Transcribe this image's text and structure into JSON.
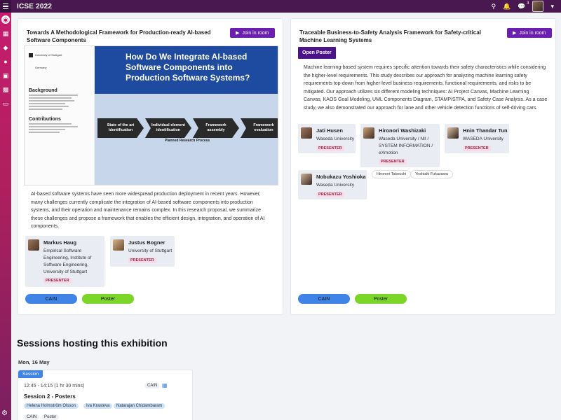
{
  "app": {
    "title": "ICSE 2022"
  },
  "topbar": {
    "icons": [
      "search-icon",
      "bell-icon",
      "chat-icon",
      "avatar",
      "chevron-down-icon"
    ],
    "message_count": "3"
  },
  "sidebar": {
    "items": [
      "home-icon",
      "calendar-icon",
      "tag-icon",
      "users-icon",
      "puzzle-icon",
      "bag-icon",
      "folder-icon"
    ],
    "bottom": "gear-icon"
  },
  "left_card": {
    "title": "Towards A Methodological Framework for Production-ready AI-based Software Components",
    "join_label": "Join in room",
    "poster": {
      "university": "University of Stuttgart",
      "university_sub": "Germany",
      "background_heading": "Background",
      "contributions_heading": "Contributions",
      "banner": "How Do We Integrate AI-based Software Components into Production Software Systems?",
      "steps": [
        "State of the art identification",
        "Individual element identification",
        "Framework assembly",
        "Framework evaluation"
      ],
      "caption": "Planned Research Process"
    },
    "abstract": "AI-based software systems have seen more widespread production deployment in recent years. However, many challenges currently complicate the integration of AI-based software components into production systems, and their operation and maintenance remains complex. In this research proposal, we summarize these challenges and propose a framework that enables the efficient design, integration, and operation of AI components.",
    "authors": [
      {
        "name": "Markus Haug",
        "affiliation": "Empirical Software Engineering, Institute of Software Engineering, University of Stuttgart",
        "badge": "PRESENTER"
      },
      {
        "name": "Justus Bogner",
        "affiliation": "University of Stuttgart",
        "badge": "PRESENTER"
      }
    ],
    "tags": [
      "CAIN",
      "Poster"
    ]
  },
  "right_card": {
    "title": "Traceable Business-to-Safety Analysis Framework for Safety-critical Machine Learning Systems",
    "join_label": "Join in room",
    "open_poster_label": "Open Poster",
    "abstract": "Machine learning-based system requires specific attention towards their safety characteristics while considering the higher-level requirements. This study describes our approach for analyzing machine learning safety requirements top-down from higher-level business requirements, functional requirements, and risks to be mitigated. Our approach utilizes six different modeling techniques: AI Project Canvas, Machine Learning Canvas, KAOS Goal Modeling, UML Components Diagram, STAMP/STPA, and Safety Case Analysis. As a case study, we also demonstrated our approach for lane and other vehicle detection functions of self-driving cars.",
    "authors": [
      {
        "name": "Jati Husen",
        "affiliation": "Waseda University",
        "badge": "PRESENTER"
      },
      {
        "name": "Hironori Washizaki",
        "affiliation": "Waseda University / NII / SYSTEM INFORMATION / eXmotion",
        "badge": "PRESENTER"
      },
      {
        "name": "Hnin Thandar Tun",
        "affiliation": "WASEDA University",
        "badge": "PRESENTER"
      },
      {
        "name": "Nobukazu Yoshioka",
        "affiliation": "Waseda University",
        "badge": "PRESENTER"
      }
    ],
    "extra_authors": [
      "Hironori Takeuchi",
      "Yoshiaki Fukazawa"
    ],
    "tags": [
      "CAIN",
      "Poster"
    ]
  },
  "sessions": {
    "title": "Sessions hosting this exhibition",
    "date": "Mon, 16 May",
    "card": {
      "badge": "Session",
      "time": "12:45 - 14:15 (1 hr 30 mins)",
      "track": "CAIN",
      "name": "Session 2 - Posters",
      "chairs": [
        "Helena Holmström Olsson",
        "Iva Krasteva",
        "Natarajan Chidambaram"
      ],
      "tags": [
        "CAIN",
        "Poster"
      ]
    }
  },
  "colors": {
    "topbar": "#4a1850",
    "sidebar": "#c61c6f",
    "join_button": "#6a1fb0",
    "cain_tag": "#3f84e6",
    "poster_tag": "#7cd627",
    "presenter_text": "#a0234a"
  }
}
